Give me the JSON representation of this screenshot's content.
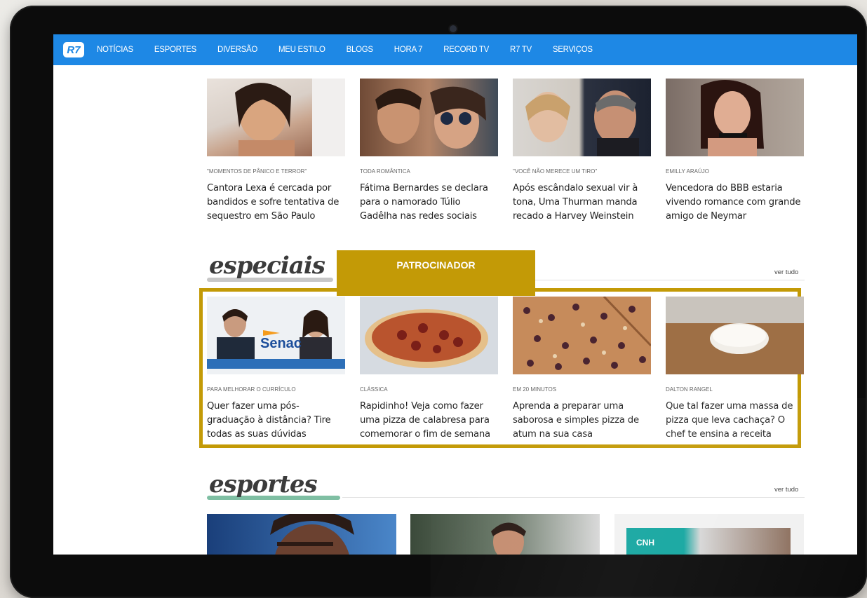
{
  "nav": {
    "logo": "R7",
    "items": [
      "NOTÍCIAS",
      "ESPORTES",
      "DIVERSÃO",
      "MEU ESTILO",
      "BLOGS",
      "HORA 7",
      "RECORD TV",
      "R7 TV",
      "SERVIÇOS"
    ]
  },
  "top_cards": [
    {
      "kicker": "\"MOMENTOS DE PÂNICO E TERROR\"",
      "headline": "Cantora Lexa é cercada por bandidos e sofre tentativa de sequestro em São Paulo"
    },
    {
      "kicker": "TODA ROMÂNTICA",
      "headline": "Fátima Bernardes se declara para o namorado Túlio Gadêlha nas redes sociais"
    },
    {
      "kicker": "\"VOCÊ NÃO MERECE UM TIRO\"",
      "headline": "Após escândalo sexual vir à tona, Uma Thurman manda recado a Harvey Weinstein"
    },
    {
      "kicker": "EMILLY ARAÚJO",
      "headline": "Vencedora do BBB estaria vivendo romance com grande amigo de Neymar"
    }
  ],
  "especiais": {
    "title": "especiais",
    "ver_tudo": "ver tudo",
    "sponsor_label": "PATROCINADOR",
    "cards": [
      {
        "kicker": "PARA MELHORAR O CURRÍCULO",
        "headline": "Quer fazer uma pós-graduação à distância? Tire todas as suas dúvidas",
        "logo_text": "Senac"
      },
      {
        "kicker": "CLÁSSICA",
        "headline": "Rapidinho! Veja como fazer uma pizza de calabresa para comemorar o fim de semana"
      },
      {
        "kicker": "EM 20 MINUTOS",
        "headline": "Aprenda a preparar uma saborosa e simples pizza de atum na sua casa"
      },
      {
        "kicker": "DALTON RANGEL",
        "headline": "Que tal fazer uma massa de pizza que leva cachaça? O chef te ensina a receita"
      }
    ]
  },
  "esportes": {
    "title": "esportes",
    "ver_tudo": "ver tudo",
    "ad_text": "CNH"
  },
  "colors": {
    "nav_blue": "#1e88e5",
    "sponsor_gold": "#c39a06",
    "especiais_underline": "#bdbdbd",
    "esportes_underline": "#7fbfa3"
  }
}
